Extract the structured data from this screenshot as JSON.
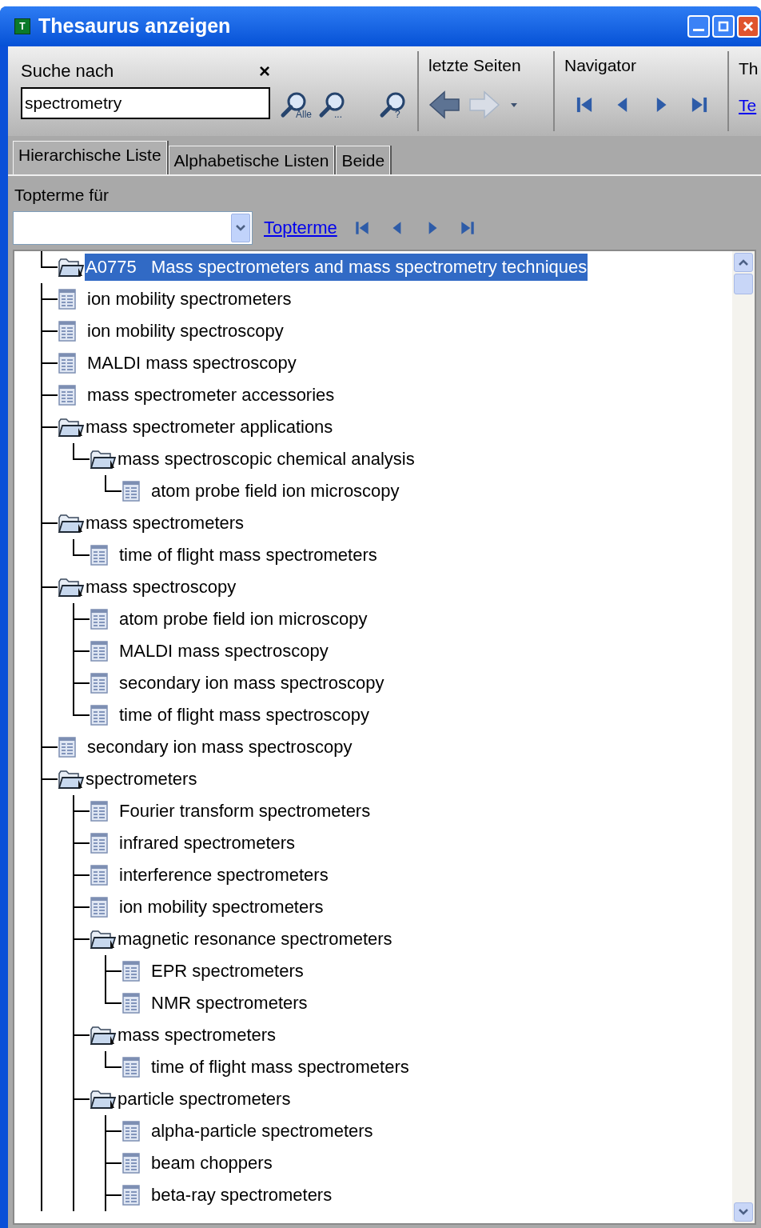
{
  "window": {
    "title": "Thesaurus anzeigen",
    "icon_letter": "T"
  },
  "search": {
    "label": "Suche nach",
    "clear": "×",
    "value": "spectrometry",
    "buttons": [
      {
        "badge": "Alle"
      },
      {
        "badge": "..."
      },
      {
        "badge": "?"
      }
    ]
  },
  "history": {
    "label": "letzte Seiten",
    "back_disabled": false,
    "forward_disabled": true
  },
  "navigator": {
    "label": "Navigator"
  },
  "section_4": {
    "label": "Th",
    "link": "Te"
  },
  "tabs": [
    {
      "label": "Hierarchische Liste",
      "selected": true
    },
    {
      "label": "Alphabetische Listen",
      "selected": false
    },
    {
      "label": "Beide",
      "selected": false
    }
  ],
  "topterms": {
    "label": "Topterme für",
    "link": "Topterme"
  },
  "tree": {
    "root": {
      "kind": "folder",
      "label": "A0775   Mass spectrometers and mass spectrometry techniques",
      "selected": true,
      "continues": true,
      "children": [
        {
          "kind": "term",
          "label": "ion mobility spectrometers",
          "selected": false
        },
        {
          "kind": "term",
          "label": "ion mobility spectroscopy",
          "selected": false
        },
        {
          "kind": "term",
          "label": "MALDI mass spectroscopy",
          "selected": false
        },
        {
          "kind": "term",
          "label": "mass spectrometer accessories",
          "selected": false
        },
        {
          "kind": "folder",
          "label": "mass spectrometer applications",
          "selected": false,
          "children": [
            {
              "kind": "folder",
              "label": "mass spectroscopic chemical analysis",
              "selected": false,
              "children": [
                {
                  "kind": "term",
                  "label": "atom probe field ion microscopy",
                  "selected": false
                }
              ]
            }
          ]
        },
        {
          "kind": "folder",
          "label": "mass spectrometers",
          "selected": false,
          "children": [
            {
              "kind": "term",
              "label": "time of flight mass spectrometers",
              "selected": false
            }
          ]
        },
        {
          "kind": "folder",
          "label": "mass spectroscopy",
          "selected": false,
          "children": [
            {
              "kind": "term",
              "label": "atom probe field ion microscopy",
              "selected": false
            },
            {
              "kind": "term",
              "label": "MALDI mass spectroscopy",
              "selected": false
            },
            {
              "kind": "term",
              "label": "secondary ion mass spectroscopy",
              "selected": false
            },
            {
              "kind": "term",
              "label": "time of flight mass spectroscopy",
              "selected": false
            }
          ]
        },
        {
          "kind": "term",
          "label": "secondary ion mass spectroscopy",
          "selected": false
        },
        {
          "kind": "folder",
          "label": "spectrometers",
          "selected": false,
          "continues": true,
          "children": [
            {
              "kind": "term",
              "label": "Fourier transform spectrometers",
              "selected": false
            },
            {
              "kind": "term",
              "label": "infrared spectrometers",
              "selected": false
            },
            {
              "kind": "term",
              "label": "interference spectrometers",
              "selected": false
            },
            {
              "kind": "term",
              "label": "ion mobility spectrometers",
              "selected": false
            },
            {
              "kind": "folder",
              "label": "magnetic resonance spectrometers",
              "selected": false,
              "children": [
                {
                  "kind": "term",
                  "label": "EPR spectrometers",
                  "selected": false
                },
                {
                  "kind": "term",
                  "label": "NMR spectrometers",
                  "selected": false
                }
              ]
            },
            {
              "kind": "folder",
              "label": "mass spectrometers",
              "selected": false,
              "children": [
                {
                  "kind": "term",
                  "label": "time of flight mass spectrometers",
                  "selected": false
                }
              ]
            },
            {
              "kind": "folder",
              "label": "particle spectrometers",
              "selected": false,
              "continues": true,
              "children": [
                {
                  "kind": "term",
                  "label": "alpha-particle spectrometers",
                  "selected": false
                },
                {
                  "kind": "term",
                  "label": "beam choppers",
                  "selected": false
                },
                {
                  "kind": "term",
                  "label": "beta-ray spectrometers",
                  "selected": false
                }
              ]
            }
          ]
        }
      ]
    }
  }
}
